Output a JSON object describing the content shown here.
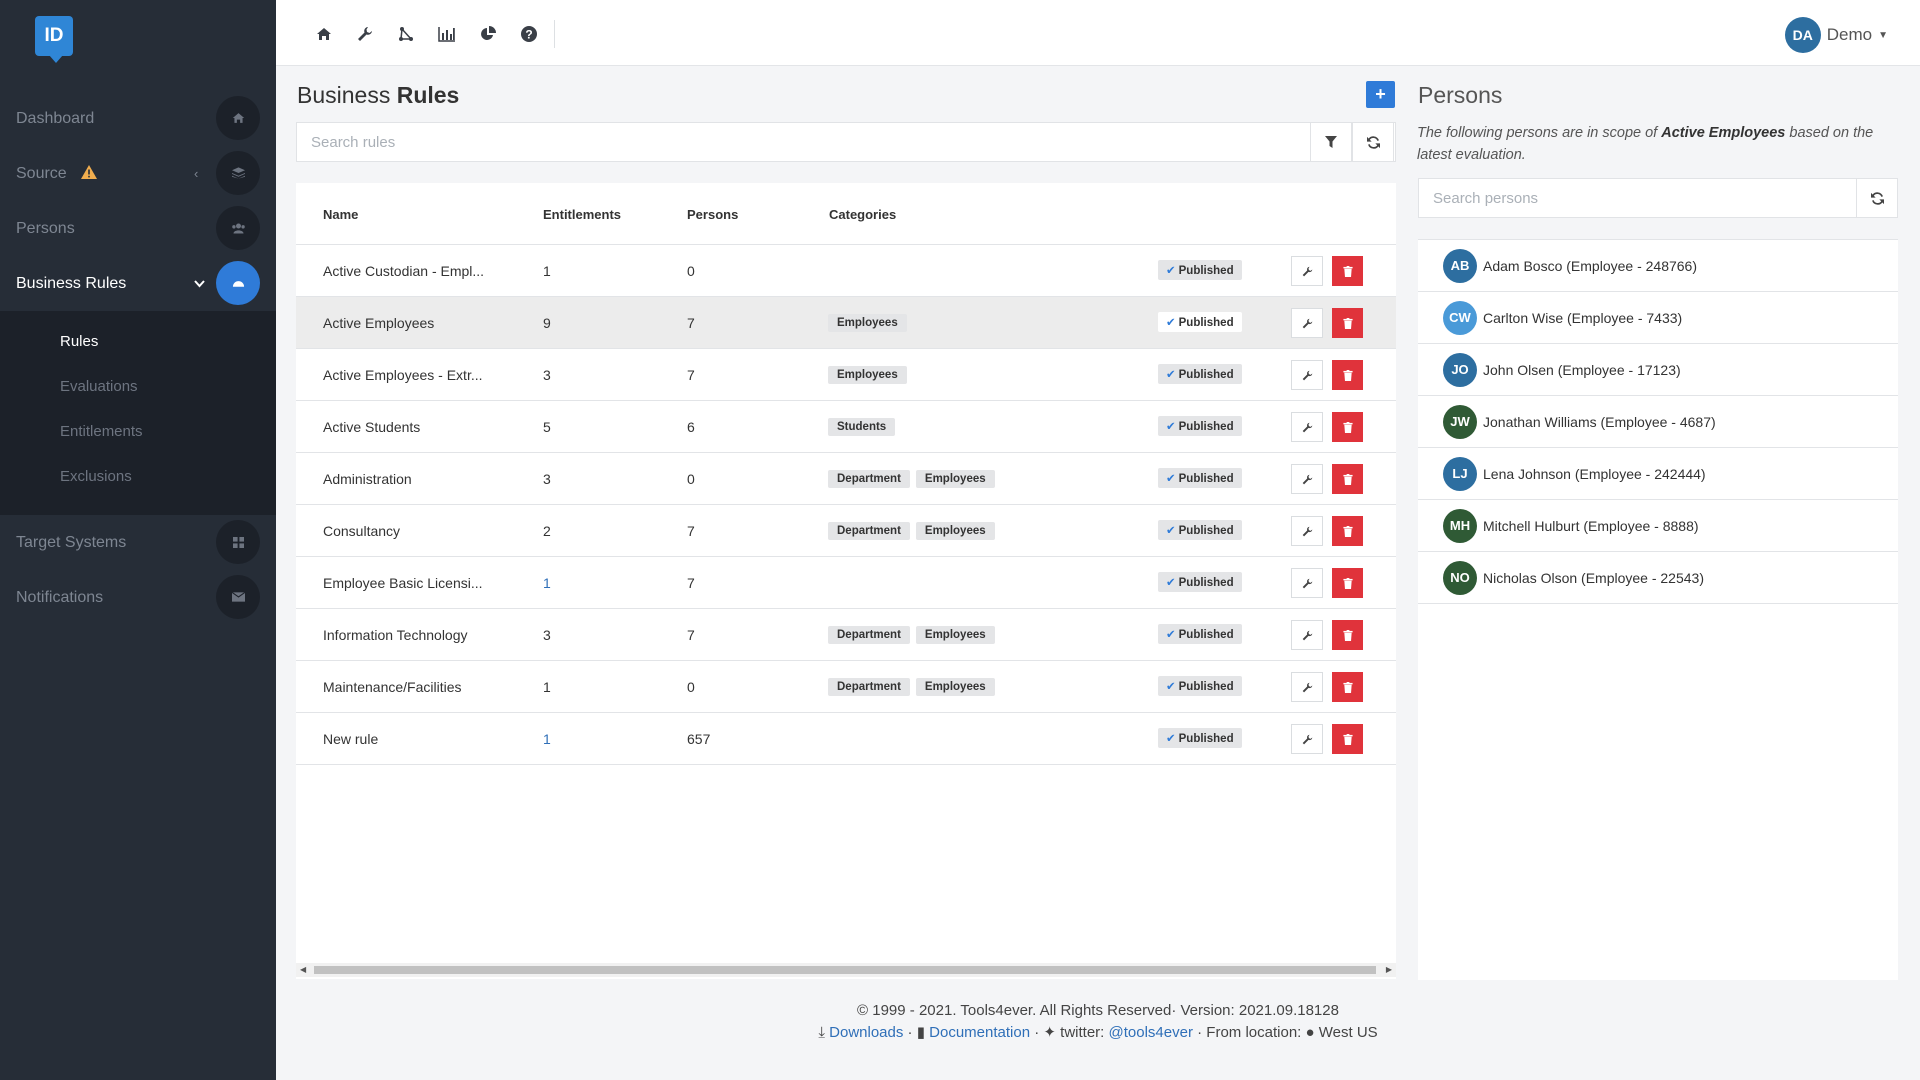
{
  "logo": "ID",
  "sidebar": {
    "items": [
      {
        "label": "Dashboard"
      },
      {
        "label": "Source"
      },
      {
        "label": "Persons"
      },
      {
        "label": "Business Rules"
      },
      {
        "label": "Target Systems"
      },
      {
        "label": "Notifications"
      }
    ],
    "sub_items": [
      {
        "label": "Rules"
      },
      {
        "label": "Evaluations"
      },
      {
        "label": "Entitlements"
      },
      {
        "label": "Exclusions"
      }
    ]
  },
  "topbar": {
    "icons": [
      "home-icon",
      "wrench-icon",
      "sitemap-icon",
      "bar-chart-icon",
      "pie-chart-icon",
      "help-icon"
    ],
    "user_initials": "DA",
    "user_name": "Demo"
  },
  "rules": {
    "title_light": "Business",
    "title_bold": "Rules",
    "search_placeholder": "Search rules",
    "columns": {
      "name": "Name",
      "entitlements": "Entitlements",
      "persons": "Persons",
      "categories": "Categories"
    },
    "rows": [
      {
        "name": "Active Custodian - Empl...",
        "entitlements": "1",
        "persons": "0",
        "categories": [],
        "status": "Published"
      },
      {
        "name": "Active Employees",
        "entitlements": "9",
        "persons": "7",
        "categories": [
          "Employees"
        ],
        "status": "Published"
      },
      {
        "name": "Active Employees - Extr...",
        "entitlements": "3",
        "persons": "7",
        "categories": [
          "Employees"
        ],
        "status": "Published"
      },
      {
        "name": "Active Students",
        "entitlements": "5",
        "persons": "6",
        "categories": [
          "Students"
        ],
        "status": "Published"
      },
      {
        "name": "Administration",
        "entitlements": "3",
        "persons": "0",
        "categories": [
          "Department",
          "Employees"
        ],
        "status": "Published"
      },
      {
        "name": "Consultancy",
        "entitlements": "2",
        "persons": "7",
        "categories": [
          "Department",
          "Employees"
        ],
        "status": "Published"
      },
      {
        "name": "Employee Basic Licensi...",
        "entitlements": "1",
        "persons": "7",
        "categories": [],
        "status": "Published"
      },
      {
        "name": "Information Technology",
        "entitlements": "3",
        "persons": "7",
        "categories": [
          "Department",
          "Employees"
        ],
        "status": "Published"
      },
      {
        "name": "Maintenance/Facilities",
        "entitlements": "1",
        "persons": "0",
        "categories": [
          "Department",
          "Employees"
        ],
        "status": "Published"
      },
      {
        "name": "New rule",
        "entitlements": "1",
        "persons": "657",
        "categories": [],
        "status": "Published"
      }
    ]
  },
  "persons_panel": {
    "title": "Persons",
    "desc_before": "The following persons are in scope of",
    "desc_rule": "Active Employees",
    "desc_after": "based on the latest evaluation.",
    "search_placeholder": "Search persons",
    "people": [
      {
        "initials": "AB",
        "label": "Adam Bosco (Employee - 248766)",
        "color": "#2d6ea0"
      },
      {
        "initials": "CW",
        "label": "Carlton Wise (Employee - 7433)",
        "color": "#4a9ad8"
      },
      {
        "initials": "JO",
        "label": "John Olsen (Employee - 17123)",
        "color": "#2d6ea0"
      },
      {
        "initials": "JW",
        "label": "Jonathan Williams (Employee - 4687)",
        "color": "#2f5a35"
      },
      {
        "initials": "LJ",
        "label": "Lena Johnson (Employee - 242444)",
        "color": "#2d6ea0"
      },
      {
        "initials": "MH",
        "label": "Mitchell Hulburt (Employee - 8888)",
        "color": "#2f5a35"
      },
      {
        "initials": "NO",
        "label": "Nicholas Olson (Employee - 22543)",
        "color": "#2f5a35"
      }
    ]
  },
  "footer": {
    "line1": "© 1999 - 2021. Tools4ever. All Rights Reserved· Version: 2021.09.18128",
    "downloads": "Downloads",
    "documentation": "Documentation",
    "twitter_label": "twitter:",
    "twitter_handle": "@tools4ever",
    "location_label": "From location:",
    "location": "West US"
  }
}
